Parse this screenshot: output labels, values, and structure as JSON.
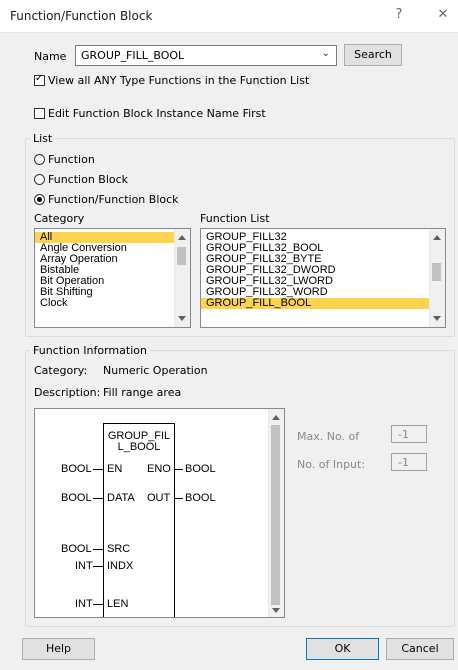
{
  "window": {
    "title": "Function/Function Block",
    "help_glyph": "?",
    "close_glyph": "✕"
  },
  "name_row": {
    "label": "Name",
    "value": "GROUP_FILL_BOOL",
    "search_label": "Search"
  },
  "options": {
    "view_all_label": "View all ANY Type Functions in the Function List",
    "view_all_checked": true,
    "edit_first_label": "Edit Function Block Instance Name First",
    "edit_first_checked": false
  },
  "list_group": {
    "legend": "List",
    "radios": [
      {
        "label": "Function",
        "selected": false
      },
      {
        "label": "Function Block",
        "selected": false
      },
      {
        "label": "Function/Function Block",
        "selected": true
      }
    ],
    "category_label": "Category",
    "categories": [
      "All",
      "Angle Conversion",
      "Array Operation",
      "Bistable",
      "Bit Operation",
      "Bit Shifting",
      "Clock"
    ],
    "selected_category": "All",
    "function_list_label": "Function List",
    "functions": [
      "GROUP_FILL32",
      "GROUP_FILL32_BOOL",
      "GROUP_FILL32_BYTE",
      "GROUP_FILL32_DWORD",
      "GROUP_FILL32_LWORD",
      "GROUP_FILL32_WORD",
      "GROUP_FILL_BOOL"
    ],
    "selected_function": "GROUP_FILL_BOOL"
  },
  "info": {
    "legend": "Function Information",
    "category_label": "Category:",
    "category_value": "Numeric Operation",
    "description_label": "Description:",
    "description_value": "Fill range area",
    "block": {
      "name_line1": "GROUP_FIL",
      "name_line2": "L_BOOL",
      "inputs": [
        {
          "type": "BOOL",
          "pin": "EN"
        },
        {
          "type": "BOOL",
          "pin": "DATA"
        },
        {
          "type": "BOOL",
          "pin": "SRC"
        },
        {
          "type": "INT",
          "pin": "INDX"
        },
        {
          "type": "INT",
          "pin": "LEN"
        }
      ],
      "outputs": [
        {
          "type": "BOOL",
          "pin": "ENO"
        },
        {
          "type": "BOOL",
          "pin": "OUT"
        }
      ]
    },
    "max_no_label": "Max. No. of",
    "max_no_value": "-1",
    "no_input_label": "No. of Input:",
    "no_input_value": "-1"
  },
  "footer": {
    "help": "Help",
    "ok": "OK",
    "cancel": "Cancel"
  }
}
